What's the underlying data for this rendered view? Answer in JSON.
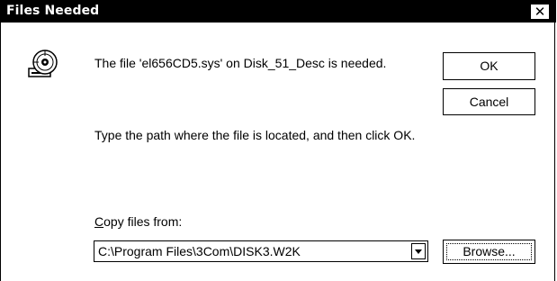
{
  "dialog": {
    "title": "Files Needed",
    "close_label": "✕",
    "message": "The file 'el656CD5.sys' on Disk_51_Desc is needed.",
    "instruction": "Type the path where the file is located, and then click OK.",
    "copy_from_label": "Copy files from:",
    "path_value": "C:\\Program Files\\3Com\\DISK3.W2K"
  },
  "buttons": {
    "ok": "OK",
    "cancel": "Cancel",
    "browse": "Browse..."
  },
  "icons": {
    "disk": "disk-icon",
    "dropdown": "chevron-down-icon"
  }
}
